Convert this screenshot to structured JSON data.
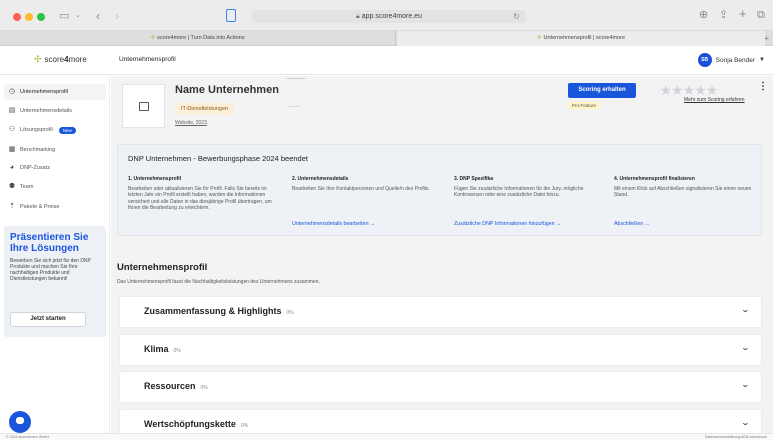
{
  "browser": {
    "url": "app.score4more.eu",
    "tabs": [
      {
        "label": "score4more | Turn Data into Actions"
      },
      {
        "label": "Unternehmensprofil | score4more"
      }
    ]
  },
  "app": {
    "logo_prefix": "score",
    "logo_bold": "4",
    "logo_suffix": "more",
    "breadcrumb": "Unternehmensprofil",
    "user_initials": "SB",
    "user_name": "Sonja Bender"
  },
  "sidebar": {
    "items": [
      {
        "label": "Unternehmensprofil",
        "icon": "clock-icon"
      },
      {
        "label": "Unternehmensdetails",
        "icon": "document-icon"
      },
      {
        "label": "Lösungsprofil",
        "icon": "people-icon",
        "badge": "New"
      },
      {
        "label": "Benchmarking",
        "icon": "grid-icon"
      },
      {
        "label": "DNP-Zusatz",
        "icon": "pie-icon"
      },
      {
        "label": "Team",
        "icon": "team-icon"
      },
      {
        "label": "Pakete & Preise",
        "icon": "upload-icon"
      }
    ],
    "promo": {
      "title": "Präsentieren Sie Ihre Lösungen",
      "text": "Bewerben Sie sich jetzt für den DNP Produkte und machen Sie Ihre nachhaltigen Produkte und Dienstleistungen bekannt!",
      "button": "Jetzt starten"
    }
  },
  "company": {
    "name": "Name Unternehmen",
    "tag": "IT-Dienstleistungen",
    "website": "Website, 2023",
    "scoring_button": "Scoring erhalten",
    "pro_badge": "Pro-Feature",
    "more_link": "Mehr zum Scoring erfahren",
    "rating_stars": 0,
    "rating_max": 5
  },
  "dnp": {
    "title": "DNP Unternehmen - Bewerbungsphase 2024 beendet",
    "steps": [
      {
        "heading": "1. Unternehmensprofil",
        "body": "Bearbeiten oder aktualisieren Sie Ihr Profil. Falls Sie bereits im letzten Jahr ein Profil erstellt haben, wurden die Informationen versichert und alle Daten in das diesjährige Profil übertragen, um Ihnen die Bearbeitung zu erleichtern.",
        "action": ""
      },
      {
        "heading": "2. Unternehmensdetails",
        "body": "Bearbeiten Sie Ihre Kontaktpersonen und Quelle/n des Profils.",
        "action": "Unternehmensdetails bearbeiten →"
      },
      {
        "heading": "3. DNP Spezifika",
        "body": "Fügen Sie zusätzliche Informationen für die Jury, mögliche Kontroversen oder eine zusätzliche Datei hinzu.",
        "action": "Zusätzliche DNP Informationen hinzufügen →"
      },
      {
        "heading": "4. Unternehmensprofil finalisieren",
        "body": "Mit einem Klick auf Abschließen signalisieren Sie einen neuen Stand.",
        "action": "Abschließen →"
      }
    ]
  },
  "profile": {
    "title": "Unternehmensprofil",
    "subtitle": "Das Unternehmensprofil fasst die Nachhaltigkeitsleistungen des Unternehmens zusammen.",
    "sections": [
      {
        "title": "Zusammenfassung & Highlights",
        "progress": "0%"
      },
      {
        "title": "Klima",
        "progress": "0%"
      },
      {
        "title": "Ressourcen",
        "progress": "0%"
      },
      {
        "title": "Wertschöpfungskette",
        "progress": "0%"
      }
    ]
  },
  "footer": {
    "left": "© 2024 score4more GmbH",
    "right": "Datenschutzerklärung   AGB   Impressum"
  },
  "colors": {
    "accent": "#1a56db",
    "tag_bg": "#fcefd8",
    "logo_green": "#9bc53d"
  }
}
